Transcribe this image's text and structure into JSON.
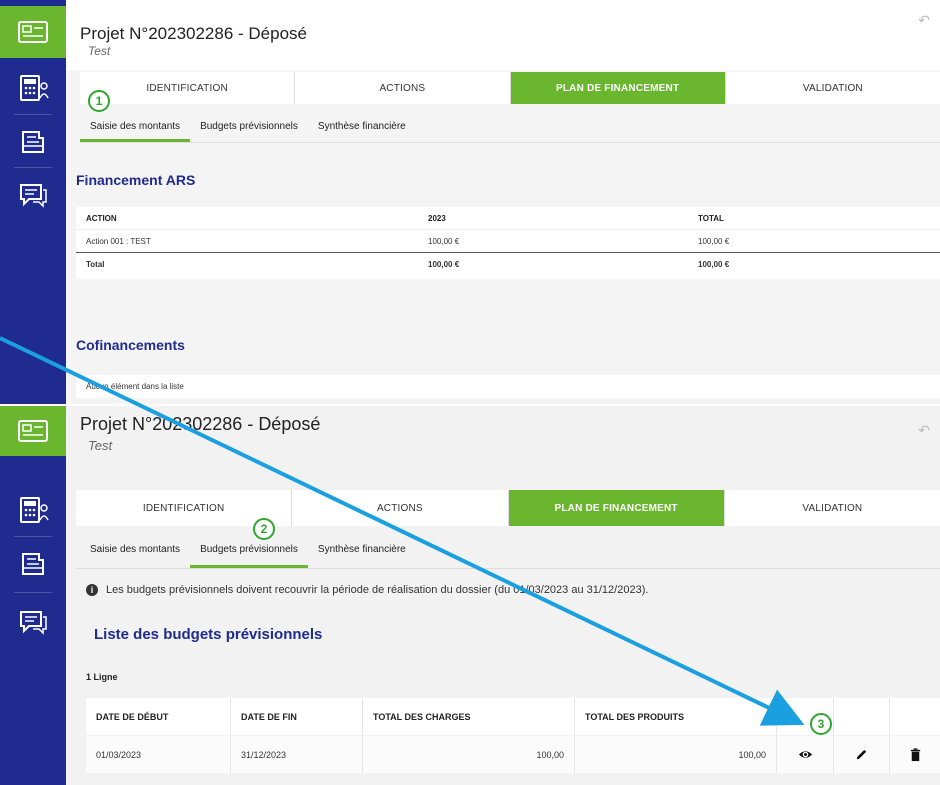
{
  "panel1": {
    "project_title": "Projet N°202302286 - Déposé",
    "project_subtitle": "Test",
    "tabs": [
      "IDENTIFICATION",
      "ACTIONS",
      "PLAN DE FINANCEMENT",
      "VALIDATION"
    ],
    "subtabs": [
      "Saisie des montants",
      "Budgets prévisionnels",
      "Synthèse financière"
    ],
    "section_ars": "Financement ARS",
    "ars_table": {
      "headers": [
        "ACTION",
        "2023",
        "TOTAL"
      ],
      "rows": [
        [
          "Action 001 : TEST",
          "100,00 €",
          "100,00 €"
        ]
      ],
      "total": [
        "Total",
        "100,00 €",
        "100,00 €"
      ]
    },
    "section_cofi": "Cofinancements",
    "empty_list": "Aucun élément dans la liste",
    "badge": "1"
  },
  "panel2": {
    "project_title": "Projet N°202302286 - Déposé",
    "project_subtitle": "Test",
    "tabs": [
      "IDENTIFICATION",
      "ACTIONS",
      "PLAN DE FINANCEMENT",
      "VALIDATION"
    ],
    "subtabs": [
      "Saisie des montants",
      "Budgets prévisionnels",
      "Synthèse financière"
    ],
    "info": "Les budgets prévisionnels doivent recouvrir la période de réalisation du dossier (du 01/03/2023 au 31/12/2023).",
    "info_icon": "i",
    "list_title": "Liste des budgets prévisionnels",
    "line_count": "1 Ligne",
    "table": {
      "headers": [
        "DATE DE DÉBUT",
        "DATE DE FIN",
        "TOTAL DES CHARGES",
        "TOTAL DES PRODUITS"
      ],
      "rows": [
        [
          "01/03/2023",
          "31/12/2023",
          "100,00",
          "100,00"
        ]
      ]
    },
    "badge_2": "2",
    "badge_3": "3"
  },
  "icons": {
    "undo": "↶",
    "sidebar": [
      "id-card-icon",
      "calculator-user-icon",
      "folder-icon",
      "chat-icon"
    ],
    "row_actions": [
      "eye-icon",
      "pencil-icon",
      "trash-icon"
    ]
  },
  "colors": {
    "sidebar": "#1f2b8f",
    "accent_green": "#6ab72f",
    "title_blue": "#1f2b8f",
    "arrow": "#1a9fe0"
  }
}
